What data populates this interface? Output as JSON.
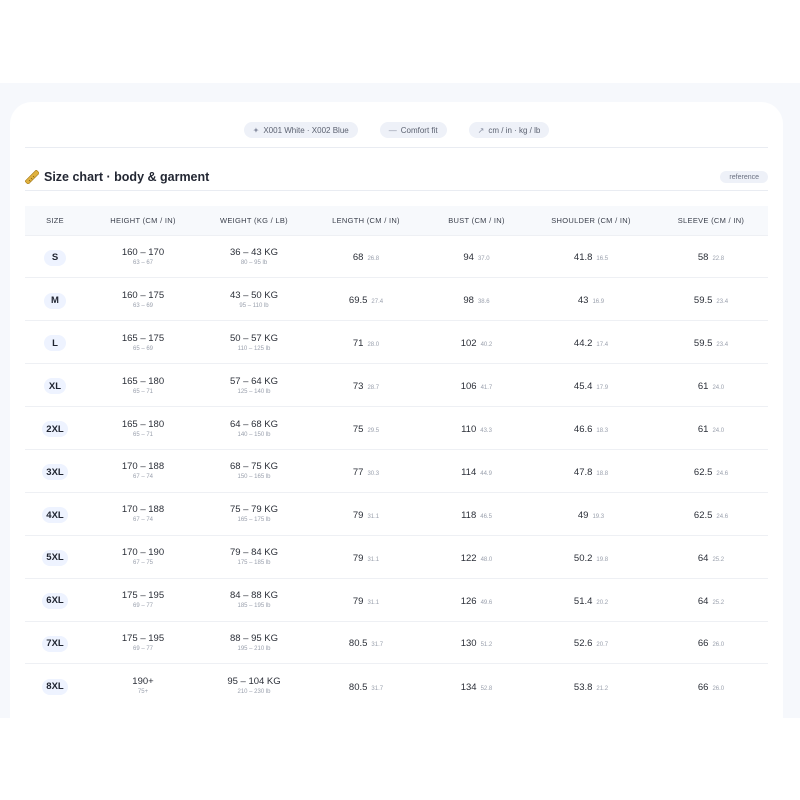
{
  "tags": [
    {
      "icon": "✦",
      "label": "X001 White · X002 Blue"
    },
    {
      "icon": "—",
      "label": "Comfort fit"
    },
    {
      "icon": "↗",
      "label": "cm / in · kg / lb"
    }
  ],
  "section": {
    "title": "Size chart · body & garment",
    "badge": "reference"
  },
  "table": {
    "headers": [
      "SIZE",
      "HEIGHT (CM / IN)",
      "WEIGHT (KG / LB)",
      "LENGTH (CM / IN)",
      "BUST (CM / IN)",
      "SHOULDER (CM / IN)",
      "SLEEVE (CM / IN)"
    ],
    "rows": [
      {
        "size": "S",
        "height": "160 – 170",
        "height_in": "63 – 67",
        "weight": "36 – 43 KG",
        "weight_lb": "80 – 95 lb",
        "length": "68",
        "length_in": "26.8",
        "bust": "94",
        "bust_in": "37.0",
        "shoulder": "41.8",
        "shoulder_in": "16.5",
        "sleeve": "58",
        "sleeve_in": "22.8"
      },
      {
        "size": "M",
        "height": "160 – 175",
        "height_in": "63 – 69",
        "weight": "43 – 50 KG",
        "weight_lb": "95 – 110 lb",
        "length": "69.5",
        "length_in": "27.4",
        "bust": "98",
        "bust_in": "38.6",
        "shoulder": "43",
        "shoulder_in": "16.9",
        "sleeve": "59.5",
        "sleeve_in": "23.4"
      },
      {
        "size": "L",
        "height": "165 – 175",
        "height_in": "65 – 69",
        "weight": "50 – 57 KG",
        "weight_lb": "110 – 125 lb",
        "length": "71",
        "length_in": "28.0",
        "bust": "102",
        "bust_in": "40.2",
        "shoulder": "44.2",
        "shoulder_in": "17.4",
        "sleeve": "59.5",
        "sleeve_in": "23.4"
      },
      {
        "size": "XL",
        "height": "165 – 180",
        "height_in": "65 – 71",
        "weight": "57 – 64 KG",
        "weight_lb": "125 – 140 lb",
        "length": "73",
        "length_in": "28.7",
        "bust": "106",
        "bust_in": "41.7",
        "shoulder": "45.4",
        "shoulder_in": "17.9",
        "sleeve": "61",
        "sleeve_in": "24.0"
      },
      {
        "size": "2XL",
        "height": "165 – 180",
        "height_in": "65 – 71",
        "weight": "64 – 68 KG",
        "weight_lb": "140 – 150 lb",
        "length": "75",
        "length_in": "29.5",
        "bust": "110",
        "bust_in": "43.3",
        "shoulder": "46.6",
        "shoulder_in": "18.3",
        "sleeve": "61",
        "sleeve_in": "24.0"
      },
      {
        "size": "3XL",
        "height": "170 – 188",
        "height_in": "67 – 74",
        "weight": "68 – 75 KG",
        "weight_lb": "150 – 165 lb",
        "length": "77",
        "length_in": "30.3",
        "bust": "114",
        "bust_in": "44.9",
        "shoulder": "47.8",
        "shoulder_in": "18.8",
        "sleeve": "62.5",
        "sleeve_in": "24.6"
      },
      {
        "size": "4XL",
        "height": "170 – 188",
        "height_in": "67 – 74",
        "weight": "75 – 79 KG",
        "weight_lb": "165 – 175 lb",
        "length": "79",
        "length_in": "31.1",
        "bust": "118",
        "bust_in": "46.5",
        "shoulder": "49",
        "shoulder_in": "19.3",
        "sleeve": "62.5",
        "sleeve_in": "24.6"
      },
      {
        "size": "5XL",
        "height": "170 – 190",
        "height_in": "67 – 75",
        "weight": "79 – 84 KG",
        "weight_lb": "175 – 185 lb",
        "length": "79",
        "length_in": "31.1",
        "bust": "122",
        "bust_in": "48.0",
        "shoulder": "50.2",
        "shoulder_in": "19.8",
        "sleeve": "64",
        "sleeve_in": "25.2"
      },
      {
        "size": "6XL",
        "height": "175 – 195",
        "height_in": "69 – 77",
        "weight": "84 – 88 KG",
        "weight_lb": "185 – 195 lb",
        "length": "79",
        "length_in": "31.1",
        "bust": "126",
        "bust_in": "49.6",
        "shoulder": "51.4",
        "shoulder_in": "20.2",
        "sleeve": "64",
        "sleeve_in": "25.2"
      },
      {
        "size": "7XL",
        "height": "175 – 195",
        "height_in": "69 – 77",
        "weight": "88 – 95 KG",
        "weight_lb": "195 – 210 lb",
        "length": "80.5",
        "length_in": "31.7",
        "bust": "130",
        "bust_in": "51.2",
        "shoulder": "52.6",
        "shoulder_in": "20.7",
        "sleeve": "66",
        "sleeve_in": "26.0"
      },
      {
        "size": "8XL",
        "height": "190+",
        "height_in": "75+",
        "weight": "95 – 104 KG",
        "weight_lb": "210 – 230 lb",
        "length": "80.5",
        "length_in": "31.7",
        "bust": "134",
        "bust_in": "52.8",
        "shoulder": "53.8",
        "shoulder_in": "21.2",
        "sleeve": "66",
        "sleeve_in": "26.0"
      }
    ]
  }
}
